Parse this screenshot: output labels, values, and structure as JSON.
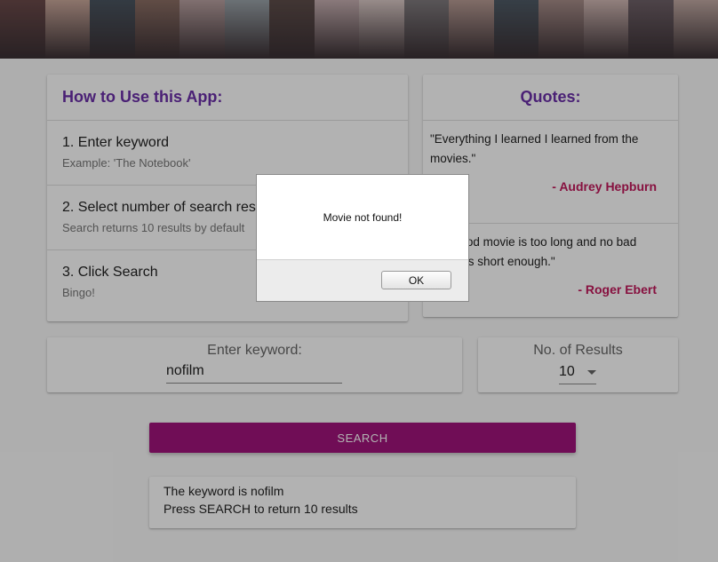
{
  "colors": {
    "accent_purple": "#6a2fa8",
    "accent_pink": "#c2185b",
    "button_bg": "#a1147c",
    "overlay": "rgba(0,0,0,0.3)"
  },
  "banner": {
    "tiles": [
      "#6b4a4a",
      "#c9a79a",
      "#4a5560",
      "#8b6e64",
      "#b8a0a0",
      "#9aa2a8",
      "#5e4d4a",
      "#c5aeb0",
      "#d9c8c5",
      "#7f7a7d",
      "#b79b94",
      "#4f5b66",
      "#a68c88",
      "#d0b7b3",
      "#6f6168",
      "#c1a9a3"
    ]
  },
  "how_to": {
    "title": "How to Use this App:",
    "steps": [
      {
        "title": "1. Enter keyword",
        "subtitle": "Example: 'The Notebook'"
      },
      {
        "title": "2. Select number of search results",
        "subtitle": "Search returns 10 results by default"
      },
      {
        "title": "3. Click Search",
        "subtitle": "Bingo!"
      }
    ]
  },
  "quotes": {
    "title": "Quotes:",
    "items": [
      {
        "text": "\"Everything I learned I learned from the movies.\"",
        "author": "- Audrey Hepburn"
      },
      {
        "text": "\"No good movie is too long and no bad movie is short enough.\"",
        "author": "- Roger Ebert"
      }
    ]
  },
  "keyword": {
    "label": "Enter keyword:",
    "value": "nofilm"
  },
  "results_count": {
    "label": "No. of Results",
    "value": "10"
  },
  "search": {
    "label": "SEARCH"
  },
  "summary": {
    "line1": "The keyword is nofilm",
    "line2": "Press SEARCH to return 10 results"
  },
  "alert": {
    "message": "Movie not found!",
    "ok_label": "OK"
  }
}
